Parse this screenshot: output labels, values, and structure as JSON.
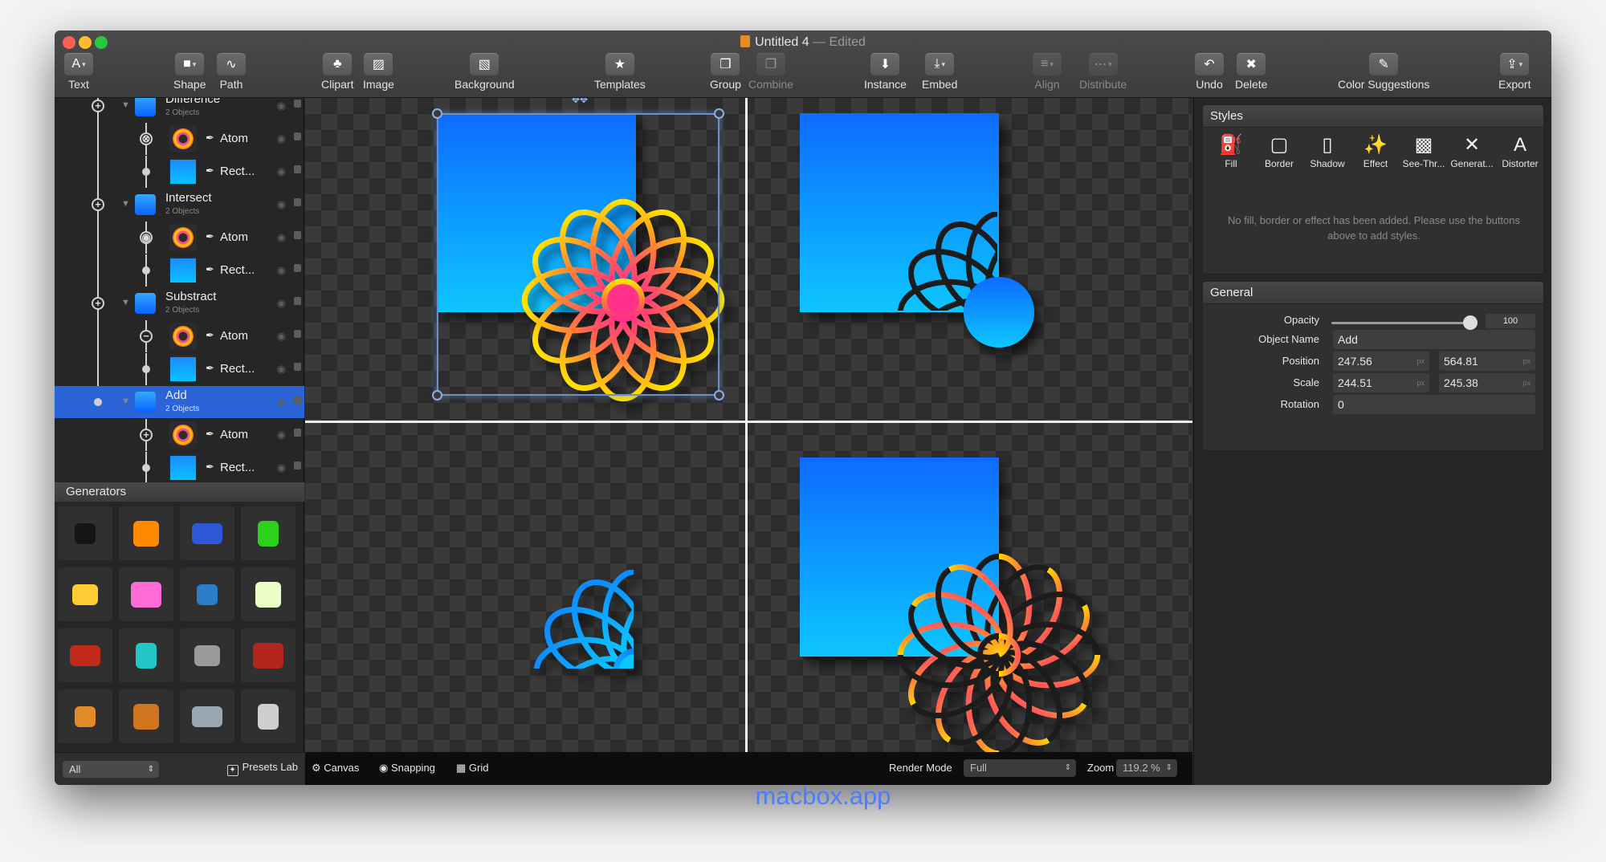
{
  "window": {
    "title": "Untitled 4",
    "edited": "— Edited"
  },
  "toolbar": [
    {
      "id": "text",
      "label": "Text",
      "icon": "A",
      "dd": true
    },
    {
      "id": "shape",
      "label": "Shape",
      "icon": "■",
      "dd": true
    },
    {
      "id": "path",
      "label": "Path",
      "icon": "∿"
    },
    {
      "id": "clipart",
      "label": "Clipart",
      "icon": "♣"
    },
    {
      "id": "image",
      "label": "Image",
      "icon": "▨"
    },
    {
      "id": "background",
      "label": "Background",
      "icon": "▧"
    },
    {
      "id": "templates",
      "label": "Templates",
      "icon": "★"
    },
    {
      "id": "group",
      "label": "Group",
      "icon": "❐"
    },
    {
      "id": "combine",
      "label": "Combine",
      "icon": "❐",
      "disabled": true
    },
    {
      "id": "instance",
      "label": "Instance",
      "icon": "⬇"
    },
    {
      "id": "embed",
      "label": "Embed",
      "icon": "⤓",
      "dd": true
    },
    {
      "id": "align",
      "label": "Align",
      "icon": "≡",
      "dd": true,
      "disabled": true
    },
    {
      "id": "distribute",
      "label": "Distribute",
      "icon": "⋯",
      "dd": true,
      "disabled": true
    },
    {
      "id": "undo",
      "label": "Undo",
      "icon": "↶"
    },
    {
      "id": "delete",
      "label": "Delete",
      "icon": "✖"
    },
    {
      "id": "color-suggestions",
      "label": "Color Suggestions",
      "icon": "✎"
    },
    {
      "id": "export",
      "label": "Export",
      "icon": "⇪",
      "dd": true
    }
  ],
  "layers": [
    {
      "name": "Difference",
      "sub": "2 Objects",
      "group": true
    },
    {
      "name": "Atom"
    },
    {
      "name": "Rect..."
    },
    {
      "name": "Intersect",
      "sub": "2 Objects",
      "group": true
    },
    {
      "name": "Atom"
    },
    {
      "name": "Rect..."
    },
    {
      "name": "Substract",
      "sub": "2 Objects",
      "group": true
    },
    {
      "name": "Atom"
    },
    {
      "name": "Rect..."
    },
    {
      "name": "Add",
      "sub": "2 Objects",
      "group": true,
      "selected": true
    },
    {
      "name": "Atom"
    },
    {
      "name": "Rect..."
    }
  ],
  "generators": {
    "title": "Generators"
  },
  "sidebar_bottom": {
    "filter": "All",
    "presets": "Presets Lab"
  },
  "canvas_bar": {
    "canvas": "Canvas",
    "snapping": "Snapping",
    "grid": "Grid",
    "render_mode_label": "Render Mode",
    "render_mode": "Full",
    "zoom_label": "Zoom",
    "zoom": "119.2 %"
  },
  "styles": {
    "title": "Styles",
    "buttons": [
      {
        "label": "Fill",
        "icon": "⛽"
      },
      {
        "label": "Border",
        "icon": "▢"
      },
      {
        "label": "Shadow",
        "icon": "▯"
      },
      {
        "label": "Effect",
        "icon": "✨"
      },
      {
        "label": "See-Thr...",
        "icon": "▩"
      },
      {
        "label": "Generat...",
        "icon": "✕"
      },
      {
        "label": "Distorter",
        "icon": "A"
      }
    ],
    "empty_message": "No fill, border or effect has been added. Please use the buttons above to add styles."
  },
  "general": {
    "title": "General",
    "opacity_label": "Opacity",
    "opacity": "100",
    "object_name_label": "Object Name",
    "object_name": "Add",
    "position_label": "Position",
    "position_x": "247.56",
    "position_y": "564.81",
    "scale_label": "Scale",
    "scale_x": "244.51",
    "scale_y": "245.38",
    "rotation_label": "Rotation",
    "rotation": "0",
    "unit": "px"
  },
  "watermark": "macbox.app",
  "colors": {
    "accent": "#2a64d6",
    "blue_top": "#0c6bff",
    "blue_bottom": "#08c6ff"
  }
}
